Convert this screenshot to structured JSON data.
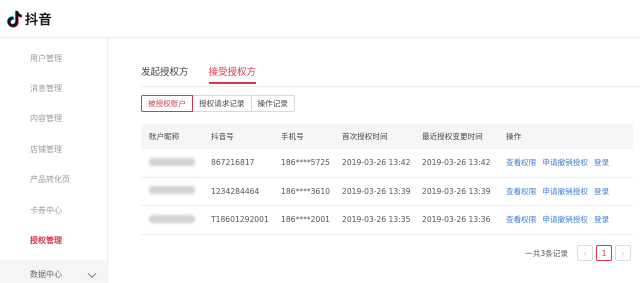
{
  "app": {
    "brand": "抖音",
    "accent": "#e0354d",
    "link_color": "#3b7ed8"
  },
  "sidebar": {
    "items": [
      {
        "label": "用户管理"
      },
      {
        "label": "消息管理"
      },
      {
        "label": "内容管理"
      },
      {
        "label": "店铺管理"
      },
      {
        "label": "产品转化页"
      },
      {
        "label": "卡券中心"
      },
      {
        "label": "授权管理",
        "active": true
      },
      {
        "label": "数据中心",
        "icon": "chevron-down-icon"
      }
    ]
  },
  "tabs": [
    {
      "label": "发起授权方"
    },
    {
      "label": "接受授权方",
      "active": true
    }
  ],
  "subtabs": [
    {
      "label": "被授权账户",
      "active": true
    },
    {
      "label": "授权请求记录"
    },
    {
      "label": "操作记录"
    }
  ],
  "table": {
    "headers": [
      "账户昵称",
      "抖音号",
      "手机号",
      "首次授权时间",
      "最近授权变更时间",
      "操作"
    ],
    "rows": [
      {
        "nickname": "",
        "douyin_id": "867216817",
        "phone": "186****5725",
        "first_time": "2019-03-26 13:42",
        "last_time": "2019-03-26 13:42"
      },
      {
        "nickname": "",
        "douyin_id": "1234284464",
        "phone": "186****3610",
        "first_time": "2019-03-26 13:39",
        "last_time": "2019-03-26 13:39"
      },
      {
        "nickname": "",
        "douyin_id": "T18601292001",
        "phone": "186****2001",
        "first_time": "2019-03-26 13:35",
        "last_time": "2019-03-26 13:36"
      }
    ],
    "actions": {
      "view": "查看权限",
      "revoke": "申请撤销授权",
      "login": "登录"
    }
  },
  "pagination": {
    "total": "一共3条记录",
    "prev": "‹",
    "current_page": "1",
    "next": "›"
  }
}
